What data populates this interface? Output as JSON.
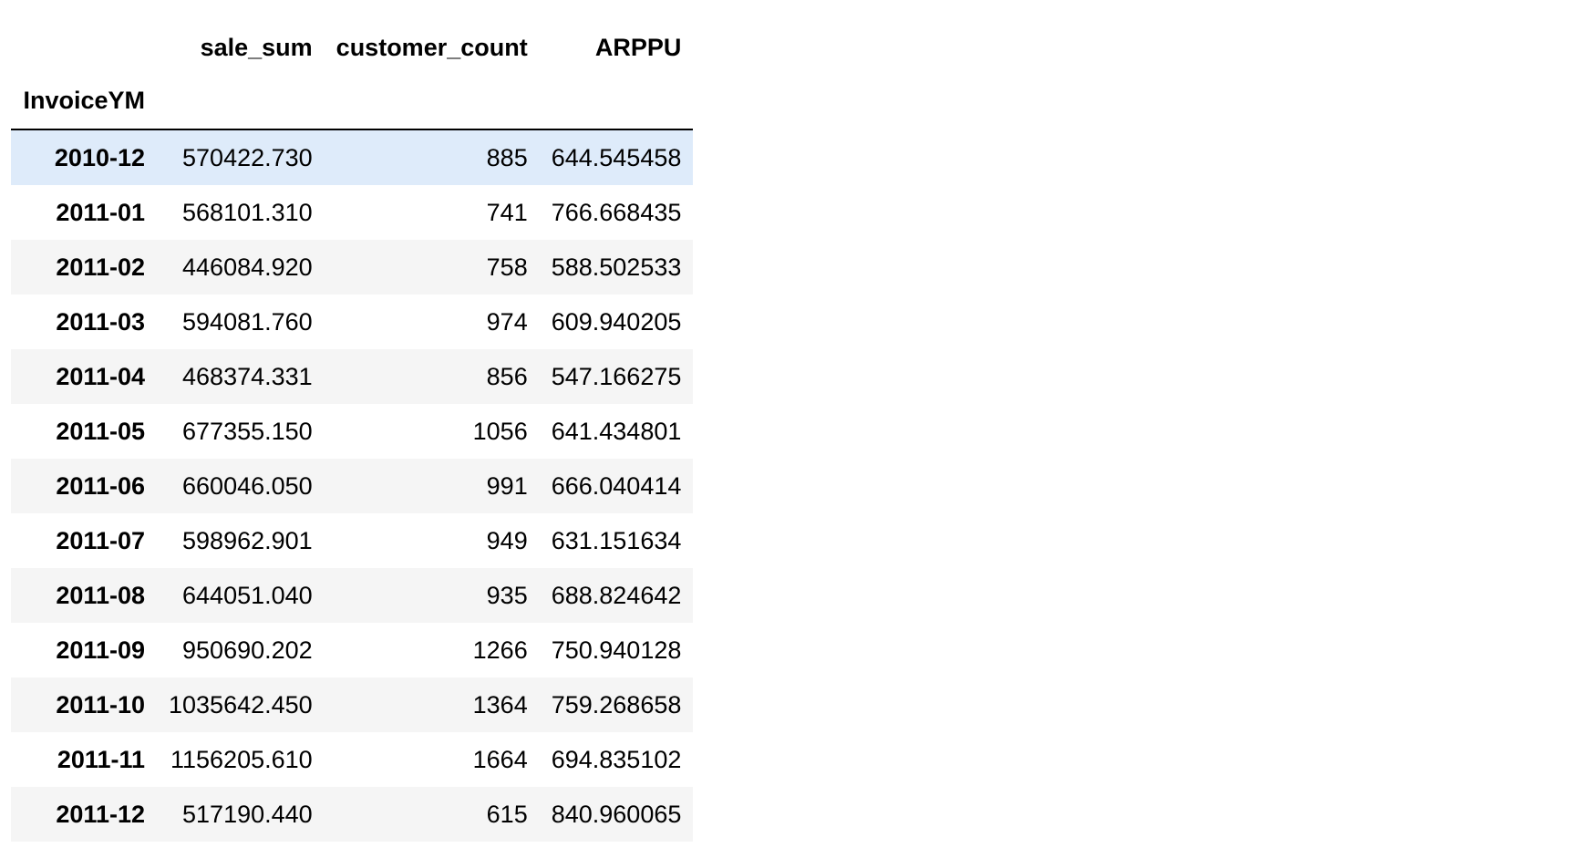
{
  "table": {
    "columns": [
      "sale_sum",
      "customer_count",
      "ARPPU"
    ],
    "index_name": "InvoiceYM",
    "rows": [
      {
        "index": "2010-12",
        "sale_sum": "570422.730",
        "customer_count": "885",
        "ARPPU": "644.545458"
      },
      {
        "index": "2011-01",
        "sale_sum": "568101.310",
        "customer_count": "741",
        "ARPPU": "766.668435"
      },
      {
        "index": "2011-02",
        "sale_sum": "446084.920",
        "customer_count": "758",
        "ARPPU": "588.502533"
      },
      {
        "index": "2011-03",
        "sale_sum": "594081.760",
        "customer_count": "974",
        "ARPPU": "609.940205"
      },
      {
        "index": "2011-04",
        "sale_sum": "468374.331",
        "customer_count": "856",
        "ARPPU": "547.166275"
      },
      {
        "index": "2011-05",
        "sale_sum": "677355.150",
        "customer_count": "1056",
        "ARPPU": "641.434801"
      },
      {
        "index": "2011-06",
        "sale_sum": "660046.050",
        "customer_count": "991",
        "ARPPU": "666.040414"
      },
      {
        "index": "2011-07",
        "sale_sum": "598962.901",
        "customer_count": "949",
        "ARPPU": "631.151634"
      },
      {
        "index": "2011-08",
        "sale_sum": "644051.040",
        "customer_count": "935",
        "ARPPU": "688.824642"
      },
      {
        "index": "2011-09",
        "sale_sum": "950690.202",
        "customer_count": "1266",
        "ARPPU": "750.940128"
      },
      {
        "index": "2011-10",
        "sale_sum": "1035642.450",
        "customer_count": "1364",
        "ARPPU": "759.268658"
      },
      {
        "index": "2011-11",
        "sale_sum": "1156205.610",
        "customer_count": "1664",
        "ARPPU": "694.835102"
      },
      {
        "index": "2011-12",
        "sale_sum": "517190.440",
        "customer_count": "615",
        "ARPPU": "840.960065"
      }
    ]
  },
  "colors": {
    "hover_row": "#deebfa",
    "striped_row": "#f5f5f5",
    "header_rule": "#000000"
  }
}
